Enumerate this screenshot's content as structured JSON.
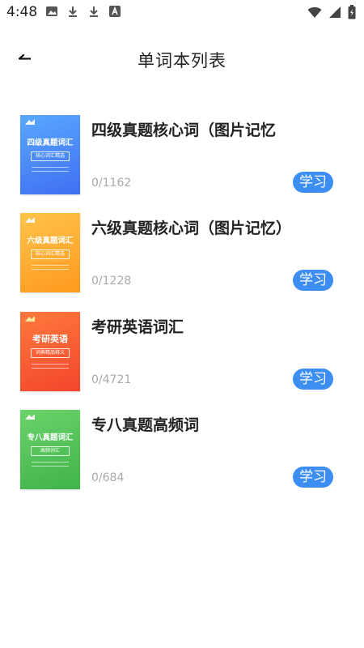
{
  "status_bar": {
    "time": "4:48"
  },
  "header": {
    "title": "单词本列表"
  },
  "books": [
    {
      "title": "四级真题核心词（图片记忆",
      "count": "0/1162",
      "action": "学习",
      "cover": {
        "title": "四级真题词汇",
        "subtitle": "核心词汇精选",
        "gradient": [
          "#5aa8ff",
          "#3f6ff2"
        ]
      }
    },
    {
      "title": "六级真题核心词（图片记忆）",
      "count": "0/1228",
      "action": "学习",
      "cover": {
        "title": "六级真题词汇",
        "subtitle": "核心词汇精选",
        "gradient": [
          "#ffc24a",
          "#ff9a1f"
        ]
      }
    },
    {
      "title": "考研英语词汇",
      "count": "0/4721",
      "action": "学习",
      "cover": {
        "title": "考研英语",
        "subtitle": "词典精品释义",
        "gradient": [
          "#ff7a3d",
          "#f2452c"
        ]
      }
    },
    {
      "title": "专八真题高频词",
      "count": "0/684",
      "action": "学习",
      "cover": {
        "title": "专八真题词汇",
        "subtitle": "高频词汇",
        "gradient": [
          "#6bd36a",
          "#3fb34a"
        ]
      }
    }
  ],
  "colors": {
    "accent": "#3c8ef2",
    "count_text": "#a9a9a9"
  }
}
